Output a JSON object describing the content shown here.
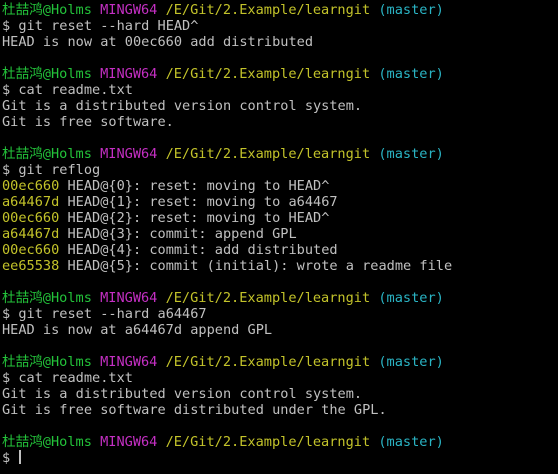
{
  "prompt": {
    "user_host": "杜喆鸿@Holms",
    "system": "MINGW64",
    "path": "/E/Git/2.Example/learngit",
    "branch": "(master)",
    "symbol": "$"
  },
  "colors": {
    "background": "#000000",
    "text": "#c0c0c0",
    "user_host": "#23c33a",
    "system": "#c42fc3",
    "path": "#c3c32a",
    "branch": "#2ab4c4",
    "hash": "#c3c32a"
  },
  "blocks": [
    {
      "command": "git reset --hard HEAD^",
      "output": [
        "HEAD is now at 00ec660 add distributed"
      ]
    },
    {
      "command": "cat readme.txt",
      "output": [
        "Git is a distributed version control system.",
        "Git is free software."
      ]
    },
    {
      "command": "git reflog",
      "reflog": [
        {
          "hash": "00ec660",
          "text": " HEAD@{0}: reset: moving to HEAD^"
        },
        {
          "hash": "a64467d",
          "text": " HEAD@{1}: reset: moving to a64467"
        },
        {
          "hash": "00ec660",
          "text": " HEAD@{2}: reset: moving to HEAD^"
        },
        {
          "hash": "a64467d",
          "text": " HEAD@{3}: commit: append GPL"
        },
        {
          "hash": "00ec660",
          "text": " HEAD@{4}: commit: add distributed"
        },
        {
          "hash": "ee65538",
          "text": " HEAD@{5}: commit (initial): wrote a readme file"
        }
      ]
    },
    {
      "command": "git reset --hard a64467",
      "output": [
        "HEAD is now at a64467d append GPL"
      ]
    },
    {
      "command": "cat readme.txt",
      "output": [
        "Git is a distributed version control system.",
        "Git is free software distributed under the GPL."
      ]
    },
    {
      "command": "",
      "active": true
    }
  ]
}
